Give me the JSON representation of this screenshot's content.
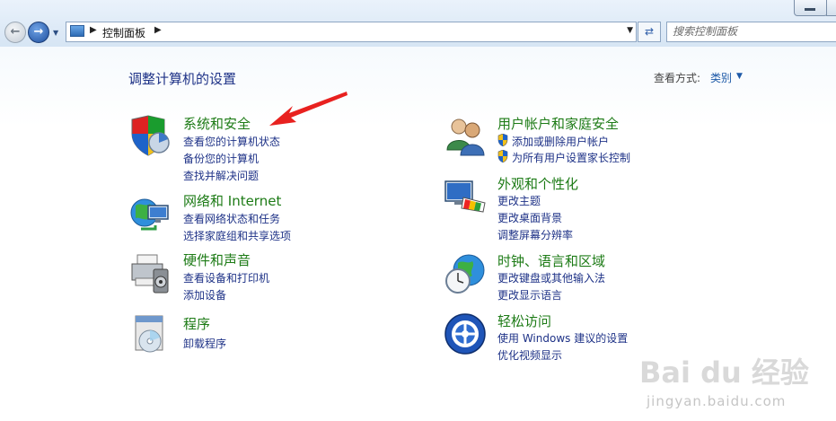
{
  "address_bar": {
    "breadcrumb": "控制面板",
    "search_placeholder": "搜索控制面板"
  },
  "header": {
    "title": "调整计算机的设置",
    "view_by_label": "查看方式:",
    "view_by_value": "类别"
  },
  "categories": [
    {
      "title": "系统和安全",
      "icon": "shield-computer-icon",
      "links": [
        "查看您的计算机状态",
        "备份您的计算机",
        "查找并解决问题"
      ]
    },
    {
      "title": "网络和 Internet",
      "icon": "network-globe-icon",
      "links": [
        "查看网络状态和任务",
        "选择家庭组和共享选项"
      ]
    },
    {
      "title": "硬件和声音",
      "icon": "printer-speaker-icon",
      "links": [
        "查看设备和打印机",
        "添加设备"
      ]
    },
    {
      "title": "程序",
      "icon": "programs-disc-icon",
      "links": [
        "卸载程序"
      ]
    },
    {
      "title": "用户帐户和家庭安全",
      "icon": "users-icon",
      "links": [
        "添加或删除用户帐户",
        "为所有用户设置家长控制"
      ],
      "links_have_shield": true
    },
    {
      "title": "外观和个性化",
      "icon": "monitor-palette-icon",
      "links": [
        "更改主题",
        "更改桌面背景",
        "调整屏幕分辨率"
      ]
    },
    {
      "title": "时钟、语言和区域",
      "icon": "clock-globe-icon",
      "links": [
        "更改键盘或其他输入法",
        "更改显示语言"
      ]
    },
    {
      "title": "轻松访问",
      "icon": "ease-of-access-icon",
      "links": [
        "使用 Windows 建议的设置",
        "优化视频显示"
      ]
    }
  ],
  "watermark": {
    "logo_text": "Bai du 经验",
    "url_text": "jingyan.baidu.com"
  },
  "colors": {
    "category_title": "#1d7b16",
    "link": "#1e3287",
    "annotation_arrow": "#e8211f"
  }
}
